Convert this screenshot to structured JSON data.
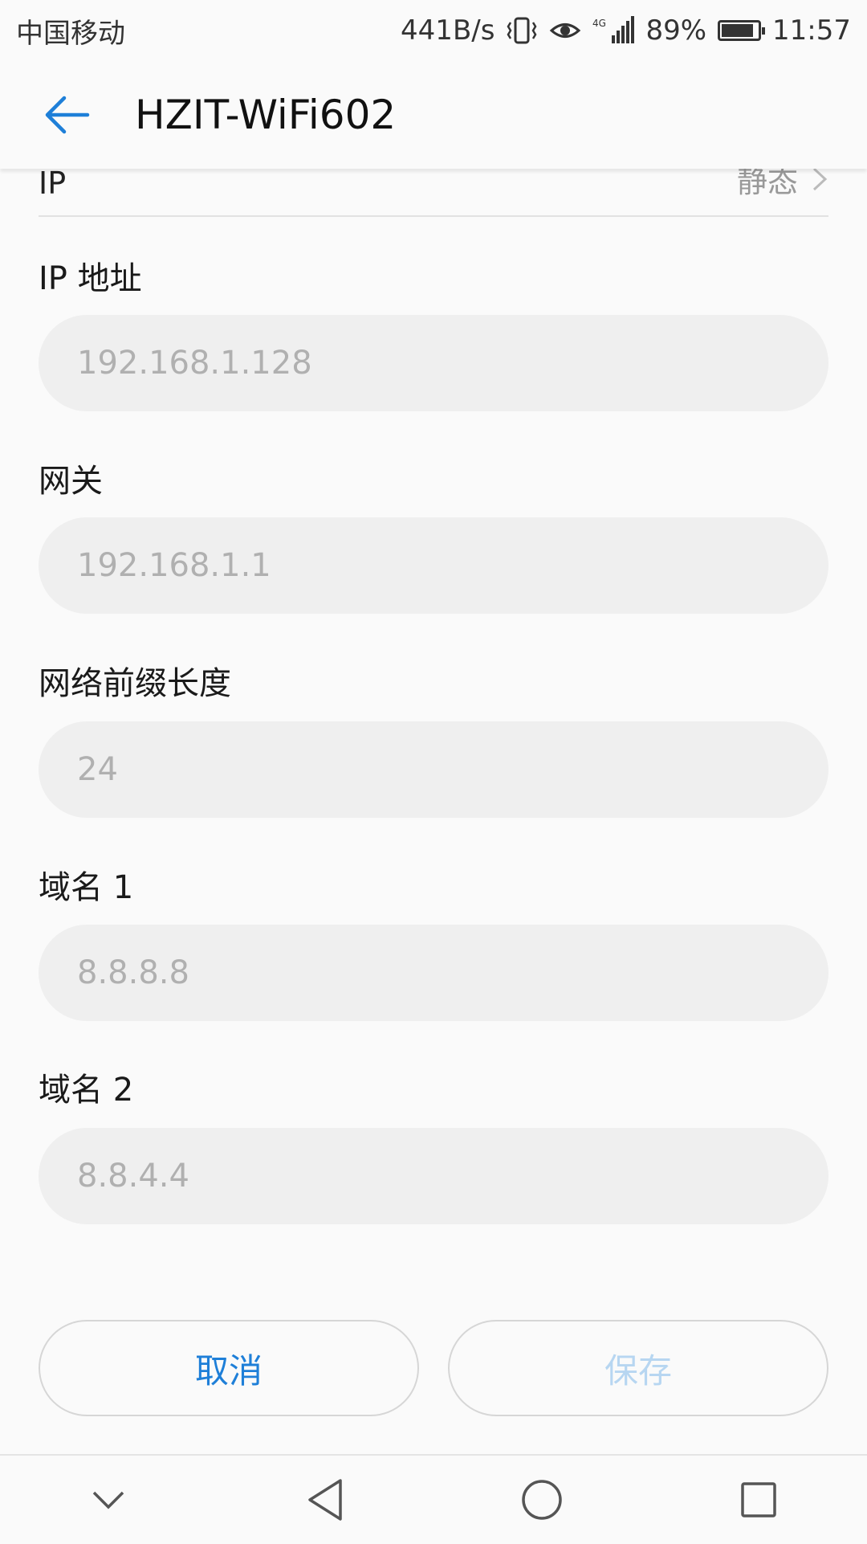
{
  "status_bar": {
    "carrier": "中国移动",
    "speed": "441B/s",
    "network": "4G",
    "battery": "89%",
    "battery_level": 0.89,
    "time": "11:57"
  },
  "app_bar": {
    "title": "HZIT-WiFi602"
  },
  "partial_row": {
    "label": "IP",
    "value": "静态"
  },
  "fields": [
    {
      "label": "IP 地址",
      "value": "192.168.1.128"
    },
    {
      "label": "网关",
      "value": "192.168.1.1"
    },
    {
      "label": "网络前缀长度",
      "value": "24"
    },
    {
      "label": "域名 1",
      "value": "8.8.8.8"
    },
    {
      "label": "域名 2",
      "value": "8.8.4.4"
    }
  ],
  "buttons": {
    "cancel": "取消",
    "save": "保存"
  },
  "colors": {
    "accent": "#1e7fd8",
    "accent_disabled": "#b7d6f1",
    "field_bg": "#efefef"
  },
  "icons": {
    "back": "arrow-left-icon",
    "nav": [
      "chevron-down-icon",
      "triangle-back-icon",
      "circle-home-icon",
      "square-recents-icon"
    ]
  }
}
